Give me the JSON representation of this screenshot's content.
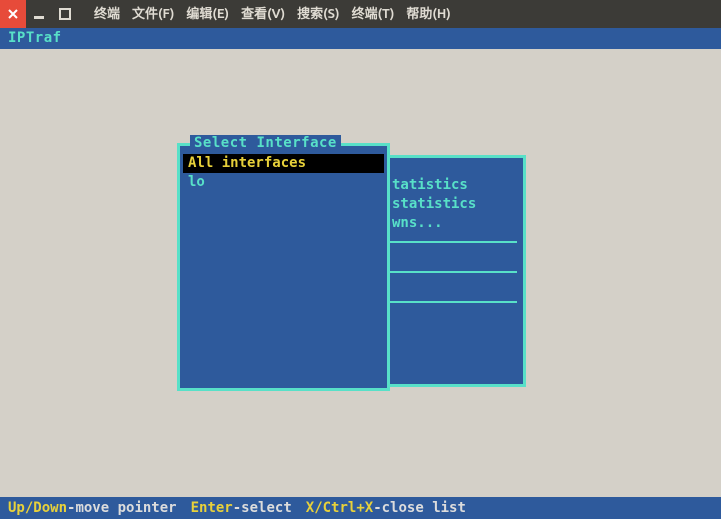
{
  "window": {
    "menu": [
      "终端",
      "文件(F)",
      "编辑(E)",
      "查看(V)",
      "搜索(S)",
      "终端(T)",
      "帮助(H)"
    ]
  },
  "app": {
    "title": "IPTraf"
  },
  "dialog": {
    "title": "Select Interface",
    "items": [
      "All interfaces",
      "lo"
    ],
    "selected_index": 0
  },
  "background_panel": {
    "lines": [
      "tatistics",
      "statistics",
      "wns..."
    ]
  },
  "status": {
    "k1": "Up/Down",
    "t1": "-move pointer",
    "k2": "Enter",
    "t2": "-select",
    "k3": "X/Ctrl+X",
    "t3": "-close list"
  }
}
